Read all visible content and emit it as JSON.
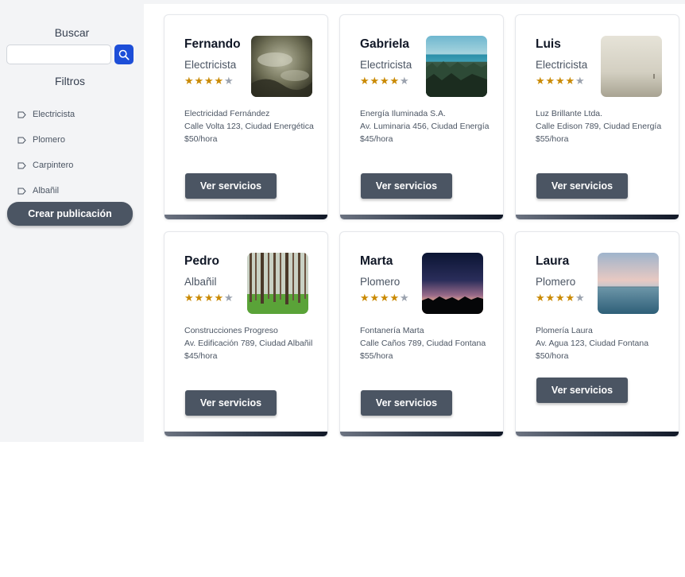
{
  "sidebar": {
    "search_title": "Buscar",
    "search_placeholder": "",
    "filters_title": "Filtros",
    "filters": [
      {
        "label": "Electricista"
      },
      {
        "label": "Plomero"
      },
      {
        "label": "Carpintero"
      },
      {
        "label": "Albañil"
      }
    ],
    "create_label": "Crear publicación"
  },
  "cards": [
    {
      "name": "Fernando",
      "role": "Electricista",
      "rating": 4,
      "image_icon": "misty-forest-photo",
      "company": "Electricidad Fernández",
      "address": "Calle Volta 123, Ciudad Energética",
      "price": "$50/hora",
      "button_label": "Ver servicios"
    },
    {
      "name": "Gabriela",
      "role": "Electricista",
      "rating": 4,
      "image_icon": "lake-shore-photo",
      "company": "Energía Iluminada S.A.",
      "address": "Av. Luminaria 456, Ciudad Energía",
      "price": "$45/hora",
      "button_label": "Ver servicios"
    },
    {
      "name": "Luis",
      "role": "Electricista",
      "rating": 4,
      "image_icon": "foggy-field-photo",
      "company": "Luz Brillante Ltda.",
      "address": "Calle Edison 789, Ciudad Energía",
      "price": "$55/hora",
      "button_label": "Ver servicios"
    },
    {
      "name": "Pedro",
      "role": "Albañil",
      "rating": 4,
      "image_icon": "pine-forest-photo",
      "company": "Construcciones Progreso",
      "address": "Av. Edificación 789, Ciudad Albañil",
      "price": "$45/hora",
      "button_label": "Ver servicios"
    },
    {
      "name": "Marta",
      "role": "Plomero",
      "rating": 4,
      "image_icon": "sunset-mountains-photo",
      "company": "Fontanería Marta",
      "address": "Calle Caños 789, Ciudad Fontana",
      "price": "$55/hora",
      "button_label": "Ver servicios"
    },
    {
      "name": "Laura",
      "role": "Plomero",
      "rating": 4,
      "image_icon": "calm-sea-photo",
      "company": "Plomería Laura",
      "address": "Av. Agua 123, Ciudad Fontana",
      "price": "$50/hora",
      "button_label": "Ver servicios"
    }
  ],
  "colors": {
    "accent": "#1d4ed8",
    "button": "#4b5563",
    "star": "#ca8a04",
    "star_empty": "#9ca3af"
  }
}
